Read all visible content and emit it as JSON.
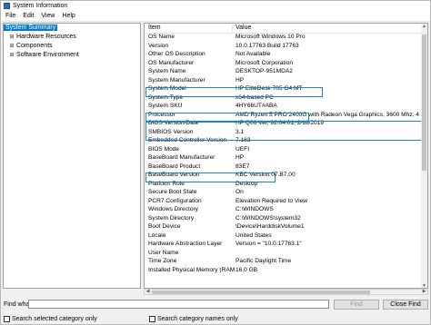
{
  "window": {
    "title": "System Information"
  },
  "menu": [
    "File",
    "Edit",
    "View",
    "Help"
  ],
  "tree": [
    {
      "label": "System Summary",
      "selected": true,
      "expander": ""
    },
    {
      "label": "Hardware Resources",
      "expander": "⊞"
    },
    {
      "label": "Components",
      "expander": "⊞"
    },
    {
      "label": "Software Environment",
      "expander": "⊞"
    }
  ],
  "table": {
    "headers": [
      "Item",
      "Value"
    ],
    "rows": [
      [
        "OS Name",
        "Microsoft Windows 10 Pro"
      ],
      [
        "Version",
        "10.0.17763 Build 17763"
      ],
      [
        "Other OS Description",
        "Not Available"
      ],
      [
        "OS Manufacturer",
        "Microsoft Corporation"
      ],
      [
        "System Name",
        "DESKTOP-951MDA2"
      ],
      [
        "System Manufacturer",
        "HP"
      ],
      [
        "System Model",
        "HP EliteDesk 705 G4 MT"
      ],
      [
        "System Type",
        "x64-based PC"
      ],
      [
        "System SKU",
        "4HY66UT#ABA"
      ],
      [
        "Processor",
        "AMD Ryzen 5 PRO 2400G with Radeon Vega Graphics, 3600 Mhz, 4 Core(s)"
      ],
      [
        "BIOS Version/Date",
        "HP Q06 Ver. 92.04.01, 2/18/2019"
      ],
      [
        "SMBIOS Version",
        "3.1"
      ],
      [
        "Embedded Controller Version",
        "7.183"
      ],
      [
        "BIOS Mode",
        "UEFI"
      ],
      [
        "BaseBoard Manufacturer",
        "HP"
      ],
      [
        "BaseBoard Product",
        "83E7"
      ],
      [
        "BaseBoard Version",
        "KBC Version 07.B7.00"
      ],
      [
        "Platform Role",
        "Desktop"
      ],
      [
        "Secure Boot State",
        "On"
      ],
      [
        "PCR7 Configuration",
        "Elevation Required to View"
      ],
      [
        "Windows Directory",
        "C:\\WINDOWS"
      ],
      [
        "System Directory",
        "C:\\WINDOWS\\system32"
      ],
      [
        "Boot Device",
        "\\Device\\HarddiskVolume1"
      ],
      [
        "Locale",
        "United States"
      ],
      [
        "Hardware Abstraction Layer",
        "Version = \"10.0.17763.1\""
      ],
      [
        "User Name",
        ""
      ],
      [
        "Time Zone",
        "Pacific Daylight Time"
      ],
      [
        "Installed Physical Memory (RAM)",
        "16.0 GB"
      ]
    ]
  },
  "find": {
    "label": "Find what:",
    "value": "",
    "find_button": "Find",
    "close_button": "Close Find",
    "check1": "Search selected category only",
    "check2": "Search category names only"
  }
}
